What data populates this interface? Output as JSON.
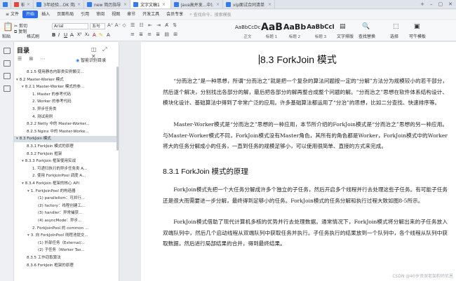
{
  "tabs": [
    {
      "label": "",
      "icon": "wps-home-icon",
      "color": "#2f7cf6"
    },
    {
      "label": "稻壳",
      "icon": "docer-icon",
      "color": "#e8453c"
    },
    {
      "label": "3年经验...OK 简历",
      "icon": "doc-icon",
      "color": "#2f7cf6"
    },
    {
      "label": "new 简历指导 v2",
      "icon": "doc-icon",
      "color": "#2f7cf6"
    },
    {
      "label": "文字文稿1",
      "icon": "doc-icon",
      "color": "#2f7cf6"
    },
    {
      "label": "Java高并发...中)...",
      "icon": "doc-icon",
      "color": "#2f7cf6"
    },
    {
      "label": "vip面试合同清单 v5",
      "icon": "doc-icon",
      "color": "#2f7cf6"
    }
  ],
  "menu": {
    "file": "文件",
    "items": [
      "开始",
      "插入",
      "页面布局",
      "引用",
      "审阅",
      "视图",
      "章节",
      "开发工具",
      "会员专享"
    ],
    "active": "开始",
    "search": "查找命令、搜索模板"
  },
  "ribbon": {
    "paste": "粘贴",
    "cut": "剪切",
    "copy": "复制",
    "format_painter": "格式刷",
    "font": "Arial",
    "size": "五号",
    "styles": [
      {
        "preview": "AaBbCcDc",
        "label": "正文"
      },
      {
        "preview": "AaB",
        "label": "标题 1"
      },
      {
        "preview": "AaBb",
        "label": "标题 2"
      },
      {
        "preview": "AaBbCcI",
        "label": "标题 3"
      }
    ],
    "text_layout": "文字排版",
    "find_replace": "查找替换",
    "select": "选择",
    "tools": "可牛模板"
  },
  "toc": {
    "title": "目录",
    "smart": "智能识别目录",
    "items": [
      {
        "text": "8.1.5 使用静态内部类实例懒汉...",
        "indent": 1
      },
      {
        "text": "8.2 Master-Worker 模式",
        "indent": 0,
        "caret": "▾"
      },
      {
        "text": "8.2.1 Master-Worker 模式的参...",
        "indent": 1,
        "caret": "▾"
      },
      {
        "text": "1. Master 的参考代码",
        "indent": 2
      },
      {
        "text": "2. Worker 的参考代码",
        "indent": 2
      },
      {
        "text": "3. 异步任务类",
        "indent": 2
      },
      {
        "text": "4. 测试用例",
        "indent": 2
      },
      {
        "text": "8.2.2 Netty 中的 Master-Worker...",
        "indent": 1
      },
      {
        "text": "8.2.3 Nginx 中的 Master-Worke...",
        "indent": 1
      },
      {
        "text": "8.3 ForkJoin 模式",
        "indent": 0,
        "caret": "▾",
        "selected": true
      },
      {
        "text": "8.3.1 ForkJoin 模式的原理",
        "indent": 1
      },
      {
        "text": "8.3.2 ForkJoin 框架",
        "indent": 1
      },
      {
        "text": "8.3.3 ForkJoin 框架使用实战",
        "indent": 1,
        "caret": "▾"
      },
      {
        "text": "1. 可递归执行的异步任务类 A...",
        "indent": 2
      },
      {
        "text": "2. 使用 ForkJoinPool 调度 A...",
        "indent": 2
      },
      {
        "text": "8.3.4 ForkJoin 框架的核心 API",
        "indent": 1,
        "caret": "▾"
      },
      {
        "text": "1. ForkJoinPool 的构造器",
        "indent": 2,
        "caret": "▾"
      },
      {
        "text": "(1) parallelism：可并行...",
        "indent": 3
      },
      {
        "text": "(2) factory：线程创建工...",
        "indent": 3
      },
      {
        "text": "(3) handler：异常捕获...",
        "indent": 3
      },
      {
        "text": "(4) asyncMode：异步...",
        "indent": 3
      },
      {
        "text": "2. ForkJoinPool 的 common ...",
        "indent": 2
      },
      {
        "text": "3. 向 ForkJoinPool 线程池提交...",
        "indent": 2,
        "caret": "▾"
      },
      {
        "text": "(1) 外部任务（External/...",
        "indent": 3
      },
      {
        "text": "(2) 子任务（Worker Tas...",
        "indent": 3
      },
      {
        "text": "8.3.5 工作窃取算法",
        "indent": 1
      },
      {
        "text": "8.3.6 ForkJoin 框架的原理",
        "indent": 1
      }
    ]
  },
  "doc": {
    "h1": "8.3  ForkJoin 模式",
    "p1": "“分而治之”是一种思想，所谓“分而治之”就是把一个复杂的算法问题按一定的“分解”方法分为规模较小的若干部分，然后逐个解决，分别找出各部分的解，最后把各部分的解再整合成整个问题的解。“分而治之”思想在软件体系结构设计、模块化设计、基础算法中得到了非常广泛的应用。许多基础算法都运用了“分治”的思想，比如二分查找、快速排序等。",
    "p2": "Master-Worker模式是“分而治之”思想的一种应用，本节所介绍的ForkJoin模式是“分而治之”思想的另一种应用。与Master-Worker模式不同，ForkJoin模式没有Master角色，其所有的角色都是Worker，ForkJoin模式中的Worker将大的任务分解成小的任务，一直到任务的规模足够小，可以使用很简单、直接的方式来完成。",
    "h2": "8.3.1  ForkJoin 模式的原理",
    "p3": "ForkJoin模式先把一个大任务分解成许多个独立的子任务，然后开启多个线程并行去处理这些子任务。有可能子任务还是很大而需要进一步分解，最终得到足够小的任务。ForkJoin模式的任务分解和执行过程大致如图8-5所示。",
    "p4": "ForkJoin模式借助了现代计算机多核的优势并行去处理数据。通常情况下，ForkJoin模式将分解出来的子任务放入双端队列中，然后几个启动线程从双端队列中获取任务并执行。子任务执行的结果放到一个队列中，各个线程从队列中获取数据，然后进行局部结果的合并，得到最终结果。"
  },
  "watermark": "CSDN @40岁资深老架构师尼恩"
}
